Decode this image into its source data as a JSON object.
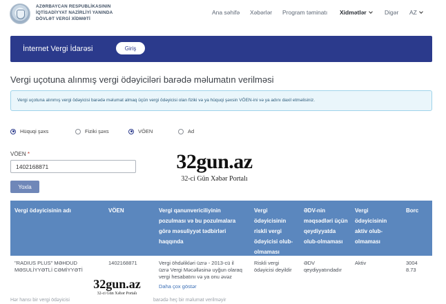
{
  "header": {
    "org_lines": [
      "AZƏRBAYCAN RESPUBLİKASININ",
      "İQTİSADİYYAT NAZİRLİYİ YANINDA",
      "DÖVLƏT VERGİ XİDMƏTİ"
    ],
    "nav": [
      "Ana səhifə",
      "Xəbərlər",
      "Program təminatı",
      "Xidmətlər",
      "Digər",
      "AZ"
    ]
  },
  "banner": {
    "title": "İnternet Vergi İdarəsi",
    "login": "Giriş"
  },
  "page_title": "Vergi uçotuna alınmış vergi ödəyiciləri barədə məlumatın verilməsi",
  "info_text": "Vergi uçotuna alınmış vergi ödəyicisi barədə məlumat almaq üçün vergi ödəyicisi olan fiziki və ya hüquqi şəxsin VÖEN-ini və ya adını daxil etməlisiniz.",
  "search_type": {
    "options": [
      "Hüquqi şəxs",
      "Fiziki şəxs",
      "VÖEN",
      "Ad"
    ],
    "selected": [
      "Hüquqi şəxs",
      "VÖEN"
    ]
  },
  "form": {
    "voen_label": "VÖEN",
    "required_mark": "*",
    "voen_value": "1402168871",
    "submit": "Yoxla"
  },
  "watermark": {
    "title": "32gun.az",
    "subtitle": "32-ci Gün Xəbər Portalı"
  },
  "table": {
    "headers": [
      "Vergi ödəyicisinin adı",
      "VÖEN",
      "Vergi qanunvericiliyinin pozulması və bu pozulmalara görə məsuliyyət tədbirləri haqqında",
      "Vergi ödəyicisinin riskli vergi ödəyicisi olub-olmaması",
      "ƏDV-nin məqsədləri üçün qeydiyyatda olub-olmaması",
      "Vergi ödəyicisinin aktiv olub-olmaması",
      "Borc"
    ],
    "row": {
      "name": "\"RADIUS PLUS\" MƏHDUD MƏSULİYYƏTLİ CƏMİYYƏTİ",
      "voen": "1402168871",
      "violation": "Vergi öhdəlikləri üzrə - 2013-cü il üzrə Vergi Məcəlləsinə uyğun olaraq vergi hesabatını və ya onu əvəz",
      "more": "Daha çox göstər",
      "risky": "Riskli vergi ödəyicisi deyildir",
      "vat": "ƏDV qeydiyyatındadır",
      "active": "Aktiv",
      "debt": "30048.73"
    }
  },
  "footer": {
    "left": "Hər hansı bir vergi ödəyicisi",
    "right": "barədə heç bir məlumat verilməyir"
  }
}
